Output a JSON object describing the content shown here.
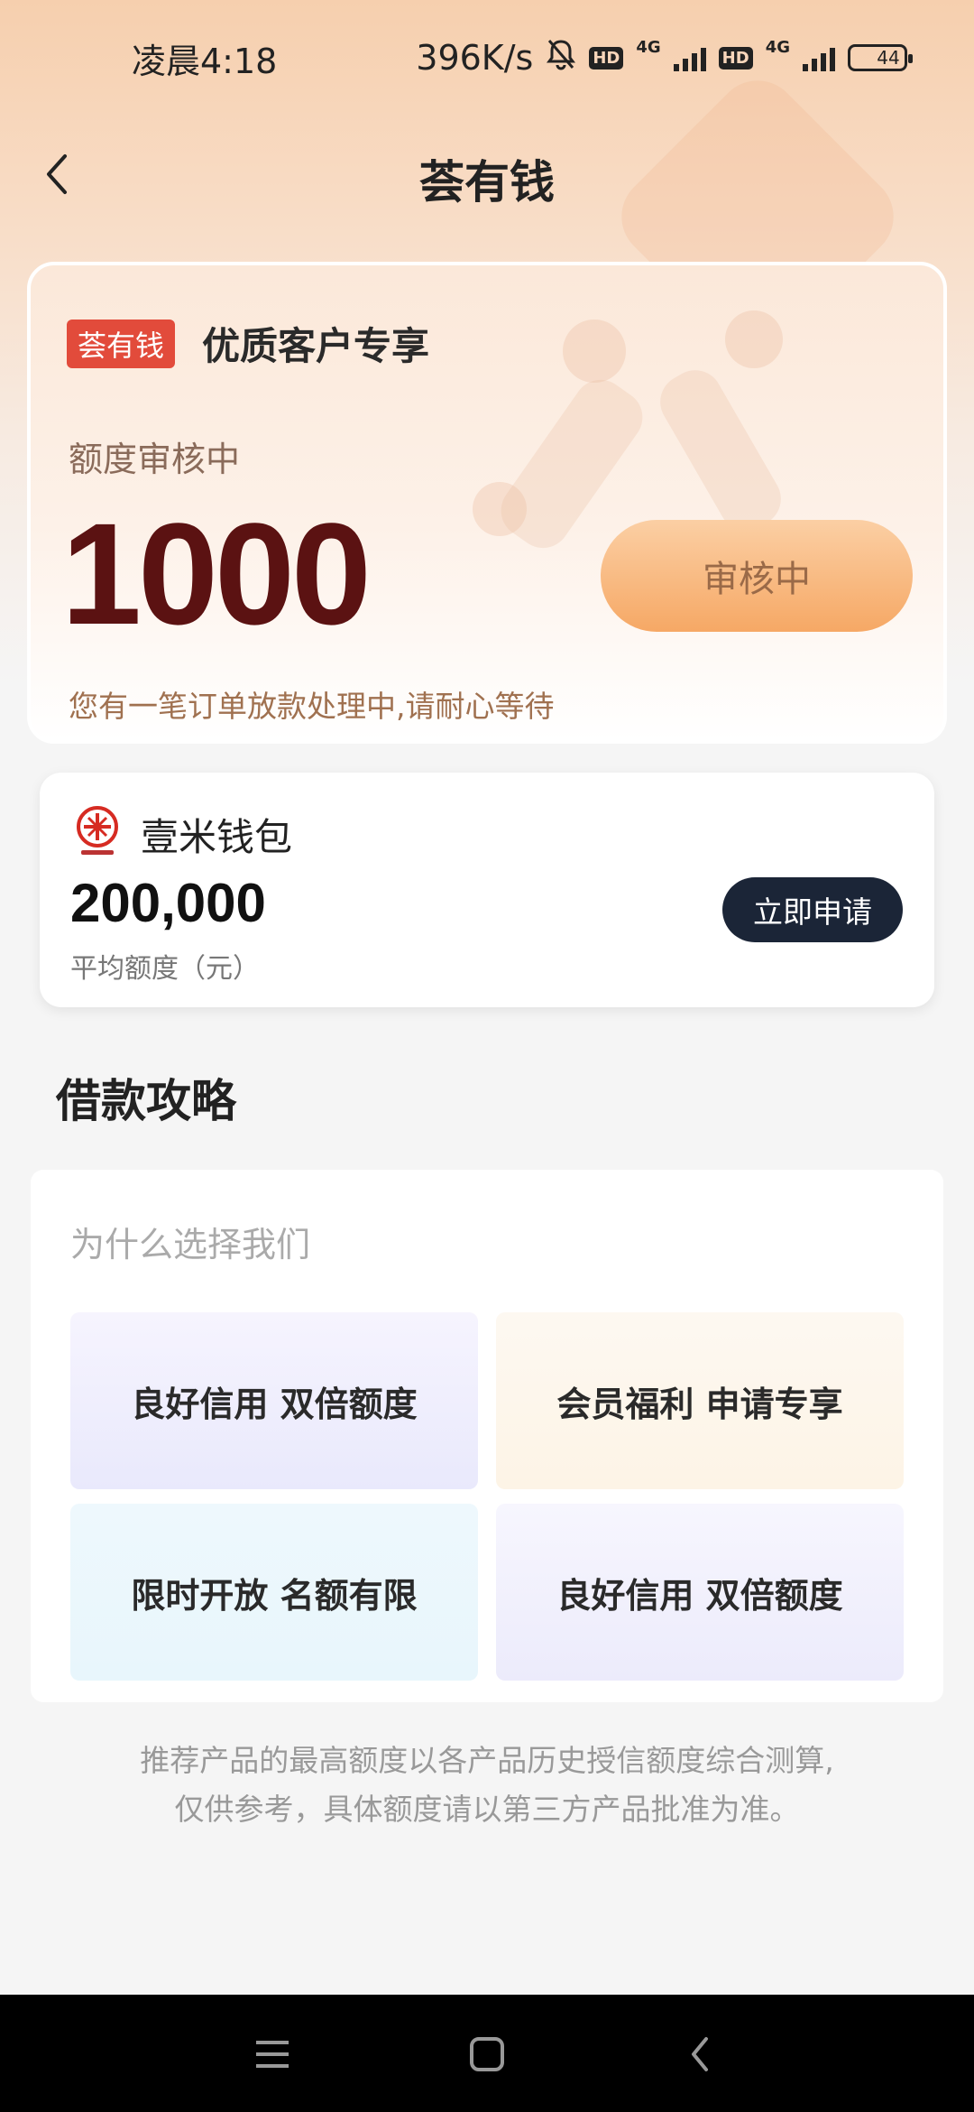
{
  "status_bar": {
    "time": "凌晨4:18",
    "net_speed": "396K/s",
    "hd1": "HD",
    "net1": "4G",
    "hd2": "HD",
    "net2": "4G",
    "battery": "44"
  },
  "nav": {
    "title": "荟有钱"
  },
  "main_card": {
    "badge": "荟有钱",
    "subtitle": "优质客户专享",
    "status_label": "额度审核中",
    "amount": "1000",
    "review_button": "审核中",
    "notice": "您有一笔订单放款处理中,请耐心等待"
  },
  "product": {
    "name": "壹米钱包",
    "amount": "200,000",
    "amount_label": "平均额度（元）",
    "apply_button": "立即申请"
  },
  "guide": {
    "section_title": "借款攻略",
    "subtitle": "为什么选择我们",
    "tiles": [
      {
        "label": "良好信用 双倍额度"
      },
      {
        "label": "会员福利 申请专享"
      },
      {
        "label": "限时开放 名额有限"
      },
      {
        "label": "良好信用 双倍额度"
      }
    ]
  },
  "disclaimer": {
    "line1": "推荐产品的最高额度以各产品历史授信额度综合测算,",
    "line2": "仅供参考，具体额度请以第三方产品批准为准。"
  },
  "colors": {
    "accent": "#f6a865",
    "brand_red": "#e24b3b",
    "amount_color": "#5b1212",
    "apply_button_bg": "#1b2537"
  },
  "icons": {
    "back": "chevron-left-icon",
    "mute": "bell-off-icon",
    "menu": "menu-icon",
    "home": "home-square-icon",
    "sys_back": "back-icon"
  }
}
